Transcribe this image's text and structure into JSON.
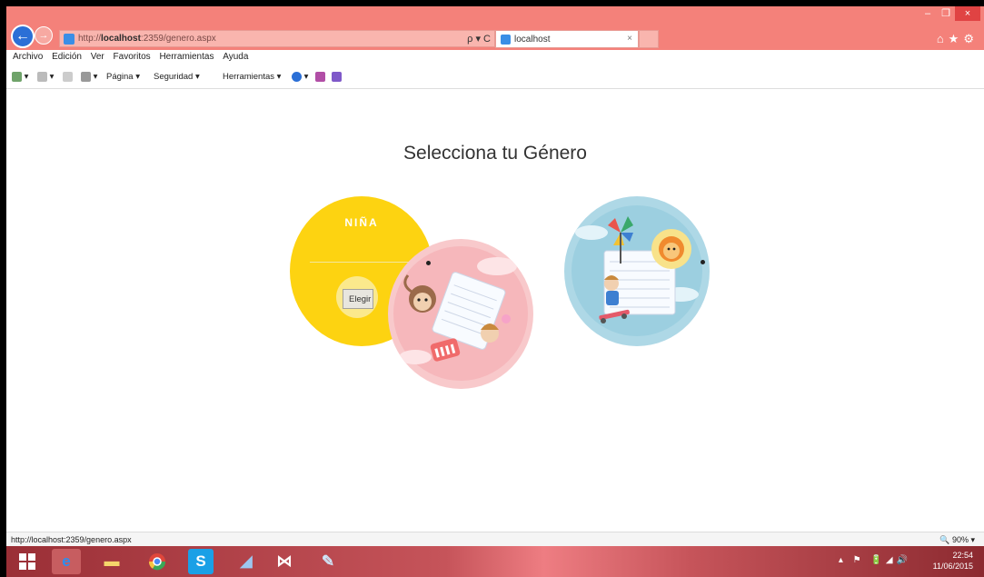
{
  "browser": {
    "address_prefix": "http://",
    "address_host": "localhost",
    "address_rest": ":2359/genero.aspx",
    "search_refresh": "ρ ▾ C",
    "tab_title": "localhost",
    "tab_close": "×",
    "window_controls": {
      "minimize": "–",
      "maximize": "❐",
      "close": "×"
    },
    "right_icons": "⌂★⚙"
  },
  "menubar": [
    "Archivo",
    "Edición",
    "Ver",
    "Favoritos",
    "Herramientas",
    "Ayuda"
  ],
  "commandbar": {
    "page": "Página ▾",
    "security": "Seguridad ▾",
    "tools": "Herramientas ▾"
  },
  "page": {
    "heading": "Selecciona tu Género",
    "nina_label": "NIÑA",
    "elegir_button": "Elegir"
  },
  "statusbar": {
    "url": "http://localhost:2359/genero.aspx",
    "zoom": "🔍 90%  ▾"
  },
  "taskbar": {
    "time": "22:54",
    "date": "11/06/2015",
    "tray_icons": "▴ ⚑ 🔋◢🔊"
  },
  "colors": {
    "titlebar": "#f4817a",
    "nina_circle": "#fdd311",
    "girl_circle": "#f8c9cb",
    "boy_circle": "#aed8e6"
  }
}
